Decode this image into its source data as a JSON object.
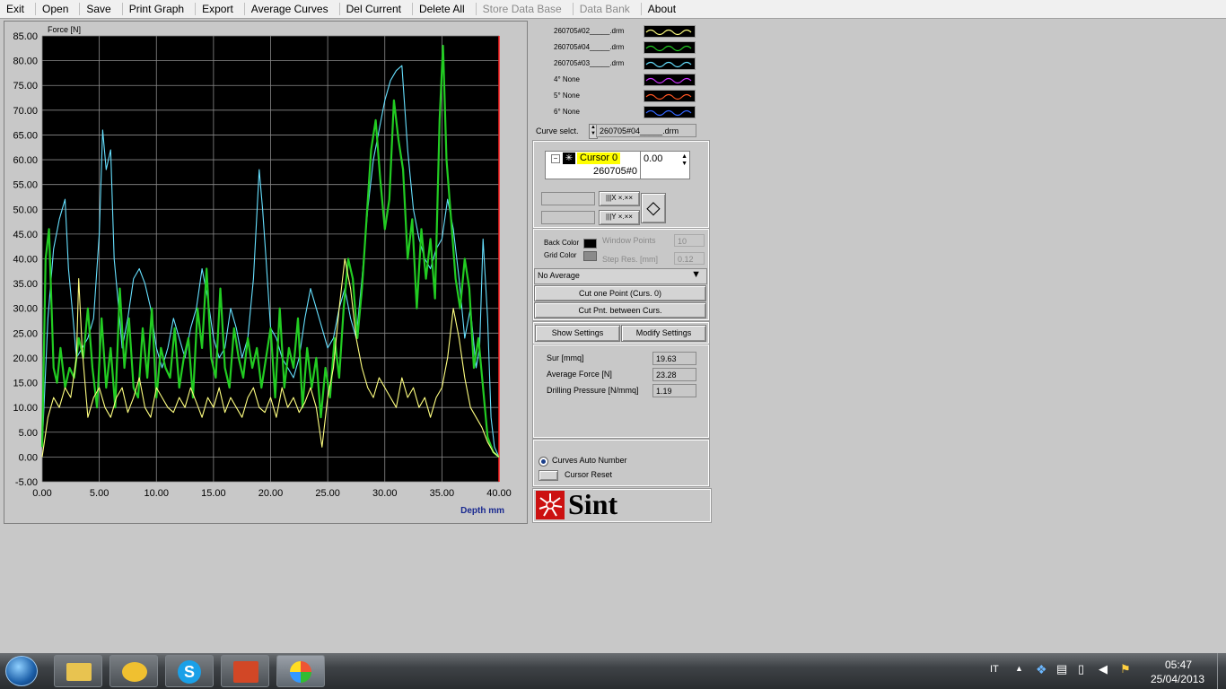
{
  "menu": [
    {
      "label": "Exit",
      "enabled": true
    },
    {
      "label": "Open",
      "enabled": true
    },
    {
      "label": "Save",
      "enabled": true
    },
    {
      "label": "Print Graph",
      "enabled": true
    },
    {
      "label": "Export",
      "enabled": true
    },
    {
      "label": "Average Curves",
      "enabled": true
    },
    {
      "label": "Del Current",
      "enabled": true
    },
    {
      "label": "Delete All",
      "enabled": true
    },
    {
      "label": "Store Data Base",
      "enabled": false
    },
    {
      "label": "Data Bank",
      "enabled": false
    },
    {
      "label": "About",
      "enabled": true
    }
  ],
  "legend": [
    {
      "label": "260705#02_____.drm",
      "color": "#ffff80"
    },
    {
      "label": "260705#04_____.drm",
      "color": "#22cc22"
    },
    {
      "label": "260705#03_____.drm",
      "color": "#66e0ff"
    },
    {
      "label": "4° None",
      "color": "#cc33ff"
    },
    {
      "label": "5° None",
      "color": "#ff5522"
    },
    {
      "label": "6° None",
      "color": "#3366ff"
    }
  ],
  "curve_select": {
    "label": "Curve selct.",
    "value": "260705#04_____.drm"
  },
  "cursor": {
    "name": "Cursor 0",
    "value": "0.00",
    "curve": "260705#0"
  },
  "settings": {
    "back_color_label": "Back Color",
    "grid_color_label": "Grid Color",
    "window_points_label": "Window Points",
    "window_points_value": "10",
    "step_res_label": "Step Res. [mm]",
    "step_res_value": "0.12",
    "average_select": "No Average",
    "cut_one": "Cut one Point (Curs. 0)",
    "cut_between": "Cut Pnt. between Curs.",
    "show_settings": "Show Settings",
    "modify_settings": "Modify Settings"
  },
  "results": [
    {
      "label": "Sur [mmq]",
      "value": "19.63"
    },
    {
      "label": "Average Force [N]",
      "value": "23.28"
    },
    {
      "label": "Drilling Pressure [N/mmq]",
      "value": "1.19"
    }
  ],
  "options": {
    "auto_number": "Curves Auto Number",
    "cursor_reset": "Cursor Reset"
  },
  "logo": {
    "text": "Sint"
  },
  "taskbar": {
    "lang": "IT",
    "time": "05:47",
    "date": "25/04/2013"
  },
  "chart_data": {
    "type": "line",
    "ylabel": "Force [N]",
    "xlabel": "Depth mm",
    "xlim": [
      0,
      40
    ],
    "ylim": [
      -5,
      85
    ],
    "xticks": [
      "0.00",
      "5.00",
      "10.00",
      "15.00",
      "20.00",
      "25.00",
      "30.00",
      "35.00",
      "40.00"
    ],
    "yticks": [
      "-5.00",
      "0.00",
      "5.00",
      "10.00",
      "15.00",
      "20.00",
      "25.00",
      "30.00",
      "35.00",
      "40.00",
      "45.00",
      "50.00",
      "55.00",
      "60.00",
      "65.00",
      "70.00",
      "75.00",
      "80.00",
      "85.00"
    ],
    "grid": true,
    "background": "#000000",
    "series": [
      {
        "name": "260705#03_____.drm",
        "color": "#66e0ff",
        "x": [
          0,
          0.5,
          1,
          1.5,
          2,
          2.3,
          2.7,
          3,
          3.5,
          4,
          4.5,
          5,
          5.3,
          5.6,
          6,
          6.3,
          6.7,
          7,
          7.5,
          8,
          8.5,
          9,
          9.5,
          10,
          10.5,
          11,
          11.5,
          12,
          12.5,
          13,
          13.5,
          14,
          14.5,
          15,
          15.5,
          16,
          16.5,
          17,
          17.5,
          18,
          18.5,
          19,
          19.3,
          19.6,
          20,
          20.5,
          21,
          21.5,
          22,
          22.5,
          23,
          23.5,
          24,
          24.5,
          25,
          25.5,
          26,
          26.5,
          27,
          27.5,
          28,
          28.5,
          29,
          29.5,
          30,
          30.5,
          31,
          31.5,
          32,
          32.5,
          33,
          33.5,
          34,
          34.5,
          35,
          35.5,
          36,
          36.5,
          37,
          37.5,
          38,
          38.3,
          38.6,
          39,
          39.3,
          39.6,
          40
        ],
        "y": [
          2,
          28,
          42,
          48,
          52,
          38,
          28,
          20,
          22,
          24,
          28,
          45,
          66,
          58,
          62,
          40,
          30,
          22,
          28,
          36,
          38,
          35,
          30,
          22,
          18,
          22,
          28,
          24,
          20,
          26,
          30,
          38,
          32,
          24,
          20,
          22,
          30,
          26,
          20,
          24,
          36,
          58,
          50,
          40,
          26,
          24,
          20,
          18,
          16,
          20,
          28,
          34,
          30,
          26,
          22,
          24,
          30,
          34,
          28,
          24,
          36,
          50,
          60,
          66,
          72,
          76,
          78,
          79,
          62,
          50,
          44,
          40,
          38,
          42,
          44,
          52,
          46,
          36,
          24,
          30,
          18,
          22,
          44,
          28,
          8,
          2,
          0
        ]
      },
      {
        "name": "260705#04_____.drm",
        "color": "#22cc22",
        "x": [
          0,
          0.3,
          0.6,
          1,
          1.3,
          1.6,
          2,
          2.4,
          2.8,
          3.2,
          3.6,
          4,
          4.4,
          4.8,
          5.2,
          5.6,
          6,
          6.4,
          6.8,
          7.2,
          7.6,
          8,
          8.4,
          8.8,
          9.2,
          9.6,
          10,
          10.4,
          10.8,
          11.2,
          11.6,
          12,
          12.4,
          12.8,
          13.2,
          13.6,
          14,
          14.4,
          14.8,
          15.2,
          15.6,
          16,
          16.4,
          16.8,
          17.2,
          17.6,
          18,
          18.4,
          18.8,
          19.2,
          19.6,
          20,
          20.4,
          20.8,
          21.2,
          21.6,
          22,
          22.4,
          22.8,
          23.2,
          23.6,
          24,
          24.4,
          24.8,
          25.2,
          25.6,
          26,
          26.4,
          26.8,
          27.2,
          27.6,
          28,
          28.4,
          28.8,
          29.2,
          29.6,
          30,
          30.4,
          30.8,
          31.2,
          31.6,
          32,
          32.4,
          32.8,
          33.2,
          33.6,
          34,
          34.4,
          34.8,
          35.1,
          35.4,
          35.8,
          36.2,
          36.6,
          37,
          37.4,
          37.8,
          38.2,
          38.6,
          39,
          39.5,
          40
        ],
        "y": [
          2,
          40,
          46,
          18,
          15,
          22,
          14,
          18,
          16,
          24,
          20,
          30,
          18,
          10,
          28,
          14,
          22,
          10,
          34,
          18,
          28,
          14,
          12,
          26,
          16,
          30,
          12,
          22,
          18,
          16,
          26,
          14,
          20,
          24,
          12,
          30,
          22,
          38,
          20,
          16,
          34,
          18,
          14,
          26,
          20,
          16,
          24,
          18,
          22,
          14,
          20,
          26,
          12,
          30,
          14,
          22,
          18,
          28,
          10,
          22,
          14,
          20,
          8,
          18,
          12,
          24,
          16,
          30,
          40,
          36,
          24,
          34,
          48,
          62,
          68,
          56,
          46,
          52,
          72,
          64,
          58,
          40,
          48,
          30,
          46,
          36,
          44,
          32,
          68,
          83,
          60,
          48,
          36,
          30,
          40,
          34,
          18,
          24,
          14,
          4,
          1,
          0
        ]
      },
      {
        "name": "260705#02_____.drm",
        "color": "#ffff80",
        "x": [
          0,
          0.5,
          1,
          1.5,
          2,
          2.5,
          3,
          3.2,
          3.5,
          4,
          4.5,
          5,
          5.5,
          6,
          6.5,
          7,
          7.5,
          8,
          8.5,
          9,
          9.5,
          10,
          10.5,
          11,
          11.5,
          12,
          12.5,
          13,
          13.5,
          14,
          14.5,
          15,
          15.5,
          16,
          16.5,
          17,
          17.5,
          18,
          18.5,
          19,
          19.5,
          20,
          20.5,
          21,
          21.5,
          22,
          22.5,
          23,
          23.5,
          24,
          24.5,
          25,
          25.5,
          26,
          26.5,
          27,
          27.5,
          28,
          28.5,
          29,
          29.5,
          30,
          30.5,
          31,
          31.5,
          32,
          32.5,
          33,
          33.5,
          34,
          34.5,
          35,
          35.5,
          36,
          36.5,
          37,
          37.5,
          38,
          38.5,
          39,
          39.5,
          40
        ],
        "y": [
          0,
          8,
          12,
          10,
          14,
          12,
          20,
          36,
          22,
          8,
          12,
          14,
          10,
          8,
          12,
          14,
          9,
          12,
          16,
          10,
          8,
          14,
          12,
          10,
          9,
          12,
          10,
          14,
          11,
          8,
          12,
          10,
          14,
          9,
          12,
          10,
          8,
          12,
          14,
          10,
          9,
          12,
          8,
          14,
          10,
          12,
          9,
          11,
          14,
          10,
          2,
          12,
          18,
          30,
          40,
          34,
          24,
          18,
          14,
          12,
          16,
          14,
          12,
          10,
          16,
          12,
          14,
          10,
          12,
          8,
          12,
          14,
          20,
          30,
          24,
          16,
          10,
          8,
          6,
          3,
          1,
          0
        ]
      }
    ]
  }
}
